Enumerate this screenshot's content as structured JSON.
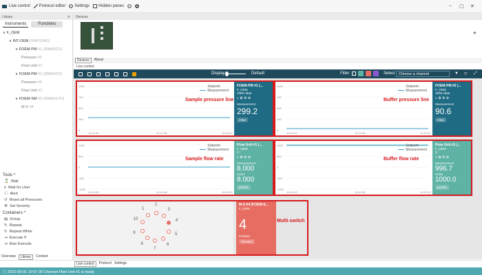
{
  "topbar": {
    "live_control": "Live control",
    "protocol_editor": "Protocol editor",
    "settings": "Settings",
    "hidden_panes": "Hidden panes"
  },
  "library": {
    "title": "Library",
    "tab_instruments": "Instruments",
    "tab_functions": "Functions",
    "tree": [
      {
        "label": "F_OEM",
        "sub": "",
        "level": 0,
        "expanded": true
      },
      {
        "label": "INT-OEM",
        "sub": "(SNFO34O)",
        "level": 1,
        "expanded": true
      },
      {
        "label": "FOEM-PM",
        "sub": "#1 (SNMOO1)",
        "level": 2,
        "expanded": true
      },
      {
        "label": "Pressure",
        "sub": "#0",
        "level": 3
      },
      {
        "label": "Flow Unit",
        "sub": "#1",
        "level": 3
      },
      {
        "label": "FOEM-PM",
        "sub": "#2 (SNMOO2)",
        "level": 2,
        "expanded": true
      },
      {
        "label": "Pressure",
        "sub": "#0",
        "level": 3
      },
      {
        "label": "Flow Unit",
        "sub": "#1",
        "level": 3
      },
      {
        "label": "FOEM-SM",
        "sub": "#3 (SNMO17O)",
        "level": 2,
        "expanded": true
      },
      {
        "label": "M-X",
        "sub": "#4",
        "level": 3
      }
    ],
    "tools_header": "Tools",
    "tools": [
      "Wait",
      "Wait for User",
      "Alert",
      "Reset all Pressures",
      "Set Severity"
    ],
    "containers_header": "Containers",
    "containers": [
      "Group",
      "Repeat",
      "Repeat While",
      "Execute If",
      "Else Execute"
    ],
    "bottom_tabs": [
      "Overview",
      "Library",
      "Context"
    ]
  },
  "devices": {
    "title": "Devices",
    "tabs": [
      "Devices",
      "About"
    ]
  },
  "live_control": {
    "title": "Live control",
    "display_label": "Display",
    "display_value": "Default",
    "filter_label": "Filter",
    "select_label": "Select",
    "select_placeholder": "Choose a channel"
  },
  "tiles": [
    {
      "title": "FOEM-PM #1 (...",
      "sub1": "F_OEM",
      "sub2": "1000 mbar",
      "meas_label": "Measurement",
      "meas_value": "299.2",
      "unit": "mbar",
      "legend": [
        "Setpoint",
        "Measurement"
      ],
      "yticks": [
        "1000",
        "750",
        "500",
        "250",
        "0"
      ],
      "xticks": [
        "10:41:53",
        "10:41:58",
        "10:42:03"
      ],
      "annotation": "Sample pressure line",
      "color": "#1f6b84"
    },
    {
      "title": "FOEM-PM #2 (...",
      "sub1": "F_OEM",
      "sub2": "1000 mbar",
      "meas_label": "Measurement",
      "meas_value": "90.6",
      "unit": "mbar",
      "legend": [
        "Setpoint",
        "Measurement"
      ],
      "yticks": [
        "1000",
        "750",
        "500",
        "250",
        "0"
      ],
      "xticks": [
        "10:41:53",
        "10:41:58",
        "10:42:03"
      ],
      "annotation": "Buffer pressure line",
      "color": "#1f6b84"
    },
    {
      "title": "Flow Unit #1 (...",
      "sub1": "F_OEM",
      "sub2": "S",
      "meas_label": "Measurement",
      "meas_value": "8.000",
      "order_label": "Order",
      "order_value": "8.000",
      "unit": "µL/min",
      "legend": [
        "Setpoint",
        "Measurement"
      ],
      "yticks": [
        "1000",
        "500",
        "0",
        "-500",
        "-1000"
      ],
      "xticks": [
        "10:41:53",
        "10:41:58",
        "10:42:03"
      ],
      "annotation": "Sample flow rate",
      "color": "#5fb3a5"
    },
    {
      "title": "Flow Unit #1 (...",
      "sub1": "F_OEM",
      "sub2": "S",
      "meas_label": "Measurement",
      "meas_value": "996.7",
      "order_label": "Order",
      "order_value": "1000.0",
      "unit": "µL/min",
      "legend": [
        "Setpoint",
        "Measurement"
      ],
      "yticks": [
        "1000",
        "500",
        "0",
        "-500",
        "-1000"
      ],
      "xticks": [
        "10:41:53",
        "10:41:58",
        "10:42:03"
      ],
      "annotation": "Buffer flow rate",
      "color": "#5fb3a5"
    }
  ],
  "multiswitch": {
    "title": "M-X #4 (FOEM-S...",
    "sub1": "F_OEM",
    "position_value": "4",
    "position_label": "Position",
    "shortest_label": "Shortest",
    "annotation": "Multi-switch",
    "ports": [
      "1",
      "2",
      "3",
      "4",
      "5",
      "6",
      "7",
      "8",
      "9",
      "10"
    ],
    "active_port": "4"
  },
  "bottom_tabs": [
    "Live control",
    "Protocol",
    "Settings"
  ],
  "status": "2022-09-01 10:07:30  Channel Flow Unit #1 is ready"
}
